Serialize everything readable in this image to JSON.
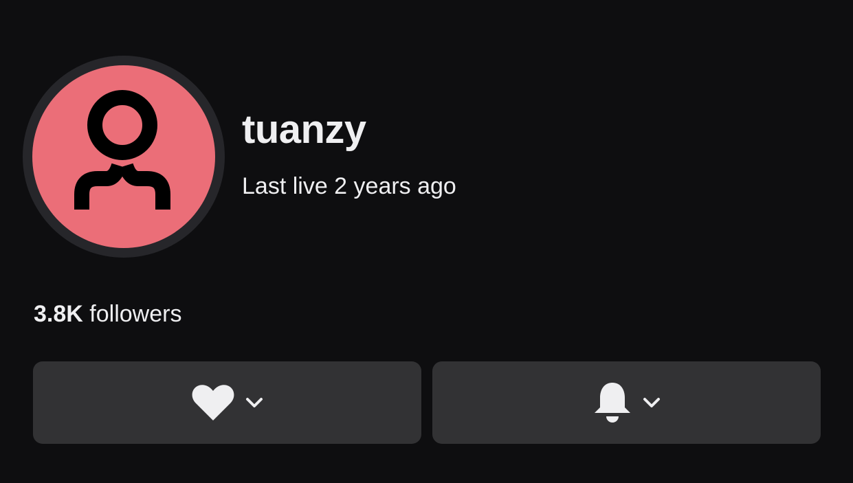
{
  "profile": {
    "username": "tuanzy",
    "last_live": "Last live 2 years ago",
    "avatar": {
      "icon": "user-silhouette-icon",
      "background_color": "#eb6e78",
      "ring_color": "#26262a"
    }
  },
  "stats": {
    "followers_count": "3.8K",
    "followers_label": "followers"
  },
  "actions": {
    "follow": {
      "icon": "heart-icon",
      "menu_icon": "chevron-down-icon"
    },
    "notifications": {
      "icon": "bell-icon",
      "menu_icon": "chevron-down-icon"
    }
  },
  "colors": {
    "background": "#0e0e10",
    "button": "#323234",
    "text": "#efeff1"
  }
}
